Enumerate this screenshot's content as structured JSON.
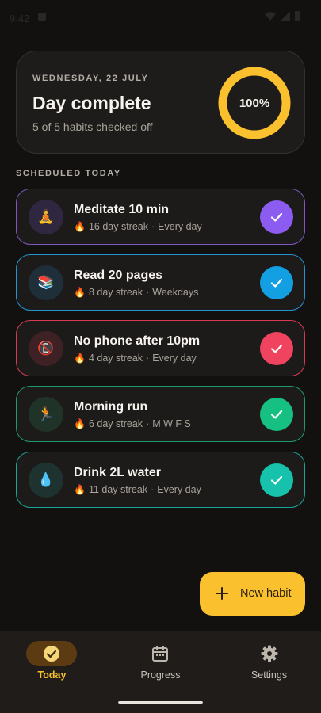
{
  "status_bar": {
    "time": "9:42"
  },
  "summary": {
    "date": "WEDNESDAY, 22 JULY",
    "title": "Day complete",
    "subtitle": "5 of 5 habits checked off",
    "progress_label": "100%",
    "progress_value": 1.0,
    "ring_color": "#fbc02d"
  },
  "section_label": "SCHEDULED TODAY",
  "habits": [
    {
      "name": "Meditate 10 min",
      "streak": "16 day streak",
      "schedule": "Every day",
      "icon": "meditation-icon",
      "emoji": "🧘",
      "accent": "#7e57c2",
      "check_color": "#8c5cf0",
      "icon_bg": "#2f2640"
    },
    {
      "name": "Read 20 pages",
      "streak": "8 day streak",
      "schedule": "Weekdays",
      "icon": "books-icon",
      "emoji": "📚",
      "accent": "#2196d3",
      "check_color": "#12a0e3",
      "icon_bg": "#1f2f3a"
    },
    {
      "name": "No phone after 10pm",
      "streak": "4 day streak",
      "schedule": "Every day",
      "icon": "no-phone-icon",
      "emoji": "📵",
      "accent": "#d83a55",
      "check_color": "#f0435f",
      "icon_bg": "#3e2125"
    },
    {
      "name": "Morning run",
      "streak": "6 day streak",
      "schedule": "M W F S",
      "icon": "runner-icon",
      "emoji": "🏃",
      "accent": "#1f9a6b",
      "check_color": "#16c083",
      "icon_bg": "#1f3328"
    },
    {
      "name": "Drink 2L water",
      "streak": "11 day streak",
      "schedule": "Every day",
      "icon": "water-drop-icon",
      "emoji": "💧",
      "accent": "#1aa597",
      "check_color": "#17c2ad",
      "icon_bg": "#1e3330"
    }
  ],
  "separator": "·",
  "fab": {
    "label": "New habit",
    "color": "#fbc02d"
  },
  "nav": [
    {
      "label": "Today",
      "icon": "check-circle-icon",
      "active": true
    },
    {
      "label": "Progress",
      "icon": "calendar-icon",
      "active": false
    },
    {
      "label": "Settings",
      "icon": "gear-icon",
      "active": false
    }
  ]
}
